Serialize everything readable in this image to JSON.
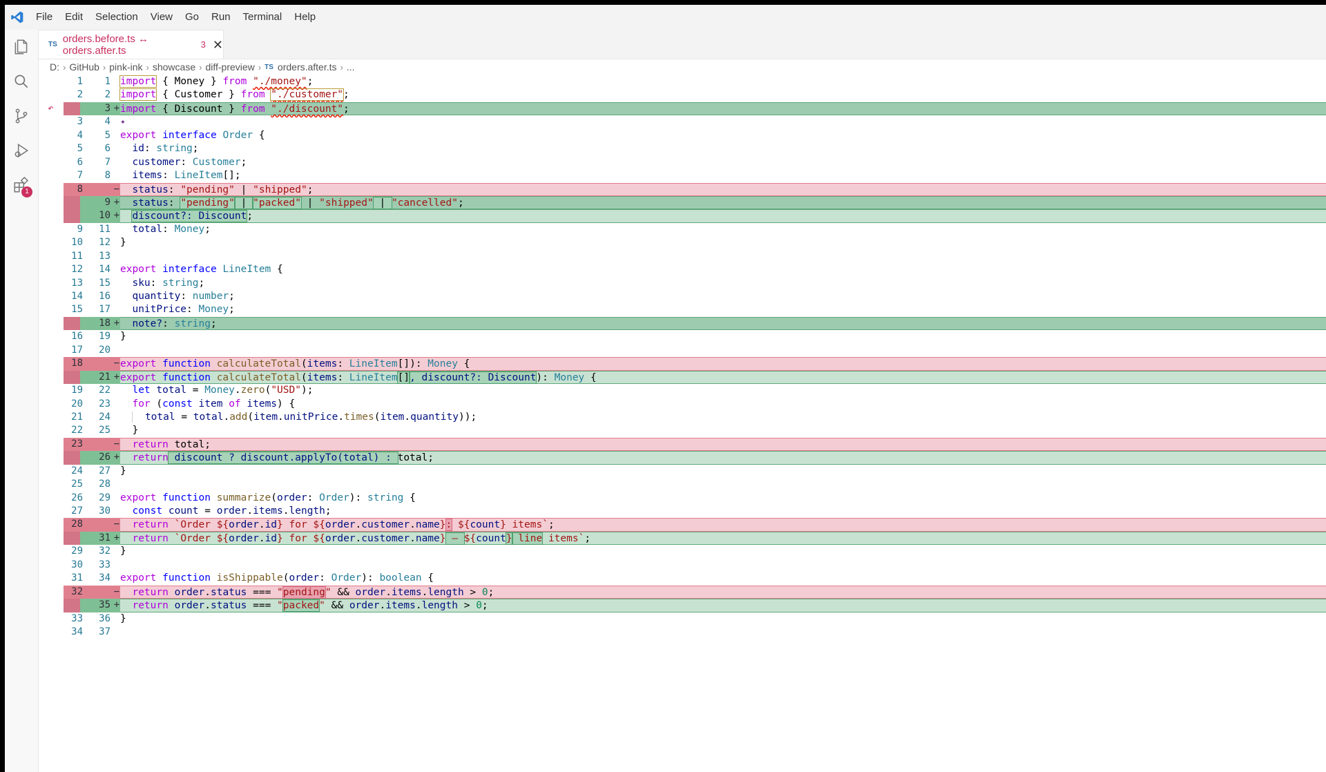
{
  "menu": [
    "File",
    "Edit",
    "Selection",
    "View",
    "Go",
    "Run",
    "Terminal",
    "Help"
  ],
  "activity": {
    "badge_count": "1"
  },
  "tab": {
    "lang": "TS",
    "title": "orders.before.ts ↔ orders.after.ts",
    "count": "3"
  },
  "breadcrumb": {
    "items": [
      "D:",
      "GitHub",
      "pink-ink",
      "showcase",
      "diff-preview"
    ],
    "lang": "TS",
    "file": "orders.after.ts",
    "ellipsis": "..."
  },
  "diff": {
    "lines": [
      {
        "a": "1",
        "b": "1",
        "m": ""
      },
      {
        "a": "2",
        "b": "2",
        "m": ""
      },
      {
        "a": "",
        "b": "3",
        "m": "+"
      },
      {
        "a": "3",
        "b": "4",
        "m": ""
      },
      {
        "a": "4",
        "b": "5",
        "m": ""
      },
      {
        "a": "5",
        "b": "6",
        "m": ""
      },
      {
        "a": "6",
        "b": "7",
        "m": ""
      },
      {
        "a": "7",
        "b": "8",
        "m": ""
      },
      {
        "a": "8",
        "b": "",
        "m": "−"
      },
      {
        "a": "",
        "b": "9",
        "m": "+"
      },
      {
        "a": "",
        "b": "10",
        "m": "+"
      },
      {
        "a": "9",
        "b": "11",
        "m": ""
      },
      {
        "a": "10",
        "b": "12",
        "m": ""
      },
      {
        "a": "11",
        "b": "13",
        "m": ""
      },
      {
        "a": "12",
        "b": "14",
        "m": ""
      },
      {
        "a": "13",
        "b": "15",
        "m": ""
      },
      {
        "a": "14",
        "b": "16",
        "m": ""
      },
      {
        "a": "15",
        "b": "17",
        "m": ""
      },
      {
        "a": "",
        "b": "18",
        "m": "+"
      },
      {
        "a": "16",
        "b": "19",
        "m": ""
      },
      {
        "a": "17",
        "b": "20",
        "m": ""
      },
      {
        "a": "18",
        "b": "",
        "m": "−"
      },
      {
        "a": "",
        "b": "21",
        "m": "+"
      },
      {
        "a": "19",
        "b": "22",
        "m": ""
      },
      {
        "a": "20",
        "b": "23",
        "m": ""
      },
      {
        "a": "21",
        "b": "24",
        "m": ""
      },
      {
        "a": "22",
        "b": "25",
        "m": ""
      },
      {
        "a": "23",
        "b": "",
        "m": "−"
      },
      {
        "a": "",
        "b": "26",
        "m": "+"
      },
      {
        "a": "24",
        "b": "27",
        "m": ""
      },
      {
        "a": "25",
        "b": "28",
        "m": ""
      },
      {
        "a": "26",
        "b": "29",
        "m": ""
      },
      {
        "a": "27",
        "b": "30",
        "m": ""
      },
      {
        "a": "28",
        "b": "",
        "m": "−"
      },
      {
        "a": "",
        "b": "31",
        "m": "+"
      },
      {
        "a": "29",
        "b": "32",
        "m": ""
      },
      {
        "a": "30",
        "b": "33",
        "m": ""
      },
      {
        "a": "31",
        "b": "34",
        "m": ""
      },
      {
        "a": "32",
        "b": "",
        "m": "−"
      },
      {
        "a": "",
        "b": "35",
        "m": "+"
      },
      {
        "a": "33",
        "b": "36",
        "m": ""
      },
      {
        "a": "34",
        "b": "37",
        "m": ""
      }
    ],
    "code": {
      "c1": [
        "import",
        "{ Money }",
        "from",
        "\"./money\"",
        ";"
      ],
      "c2": [
        "import",
        "{ Customer }",
        "from",
        "\"./customer\"",
        ";"
      ],
      "c3": [
        "import",
        "{ Discount }",
        "from",
        "\"./discount\"",
        ";"
      ],
      "c5": [
        "export",
        "interface",
        "Order",
        "{"
      ],
      "c6": [
        "id",
        ": ",
        "string",
        ";"
      ],
      "c7": [
        "customer",
        ": ",
        "Customer",
        ";"
      ],
      "c8": [
        "items",
        ": ",
        "LineItem",
        "[];"
      ],
      "c9": [
        "status",
        ": ",
        "\"pending\"",
        " | ",
        "\"shipped\"",
        ";"
      ],
      "c10": [
        "status",
        ": ",
        "\"pending\"",
        " | ",
        "\"packed\"",
        " | ",
        "\"shipped\"",
        " | ",
        "\"cancelled\"",
        ";"
      ],
      "c11": [
        "discount?: Discount",
        ";"
      ],
      "c12": [
        "total",
        ": ",
        "Money",
        ";"
      ],
      "c13": [
        "}"
      ],
      "c15": [
        "export",
        "interface",
        "LineItem",
        "{"
      ],
      "c16": [
        "sku",
        ": ",
        "string",
        ";"
      ],
      "c17": [
        "quantity",
        ": ",
        "number",
        ";"
      ],
      "c18": [
        "unitPrice",
        ": ",
        "Money",
        ";"
      ],
      "c19": [
        "note?",
        ": ",
        "string",
        ";"
      ],
      "c20": [
        "}"
      ],
      "c22": [
        "export",
        "function",
        "calculateTotal",
        "(",
        "items",
        ": ",
        "LineItem",
        "[]): ",
        "Money",
        " {"
      ],
      "c23": [
        "export",
        "function",
        "calculateTotal",
        "(",
        "items",
        ": ",
        "LineItem",
        "[]",
        ", discount?: Discount",
        "): ",
        "Money",
        " {"
      ],
      "c24": [
        "let",
        "total",
        " = ",
        "Money",
        ".",
        "zero",
        "(",
        "\"USD\"",
        ");"
      ],
      "c25": [
        "for",
        " (",
        "const",
        "item",
        "of",
        "items",
        ") {"
      ],
      "c26": [
        "total",
        " = ",
        "total",
        ".",
        "add",
        "(",
        "item",
        ".",
        "unitPrice",
        ".",
        "times",
        "(",
        "item",
        ".",
        "quantity",
        "));"
      ],
      "c27": [
        "}"
      ],
      "c28": [
        "return",
        "total",
        ";"
      ],
      "c29": [
        "return",
        " discount ? discount.applyTo(total) : ",
        "total",
        ";"
      ],
      "c30": [
        "}"
      ],
      "c32": [
        "export",
        "function",
        "summarize",
        "(",
        "order",
        ": ",
        "Order",
        "): ",
        "string",
        " {"
      ],
      "c33": [
        "const",
        "count",
        " = ",
        "order",
        ".",
        "items",
        ".",
        "length",
        ";"
      ],
      "c34": [
        "return",
        "`Order ${",
        "order",
        ".",
        "id",
        "} for ${",
        "order",
        ".",
        "customer",
        ".",
        "name",
        "}",
        ":",
        " ${",
        "count",
        "} items`",
        ";"
      ],
      "c35": [
        "return",
        "`Order ${",
        "order",
        ".",
        "id",
        "} for ${",
        "order",
        ".",
        "customer",
        ".",
        "name",
        "}",
        " — ",
        "${",
        "count",
        "}",
        " line",
        "items`",
        ";"
      ],
      "c36": [
        "}"
      ],
      "c38": [
        "export",
        "function",
        "isShippable",
        "(",
        "order",
        ": ",
        "Order",
        "): ",
        "boolean",
        " {"
      ],
      "c39": [
        "return",
        "order",
        ".",
        "status",
        " === ",
        "\"",
        "pending",
        "\"",
        " && ",
        "order",
        ".",
        "items",
        ".",
        "length",
        " > ",
        "0",
        ";"
      ],
      "c40": [
        "return",
        "order",
        ".",
        "status",
        " === ",
        "\"",
        "packed",
        "\"",
        " && ",
        "order",
        ".",
        "items",
        ".",
        "length",
        " > ",
        "0",
        ";"
      ],
      "c41": [
        "}"
      ]
    }
  },
  "colors": {
    "accent": "#c72e5e",
    "deleted_bg": "#f4ccd3",
    "inserted_bg": "#c8e2d2",
    "keyword": "#af00db",
    "type": "#267f99",
    "string": "#a31515"
  }
}
